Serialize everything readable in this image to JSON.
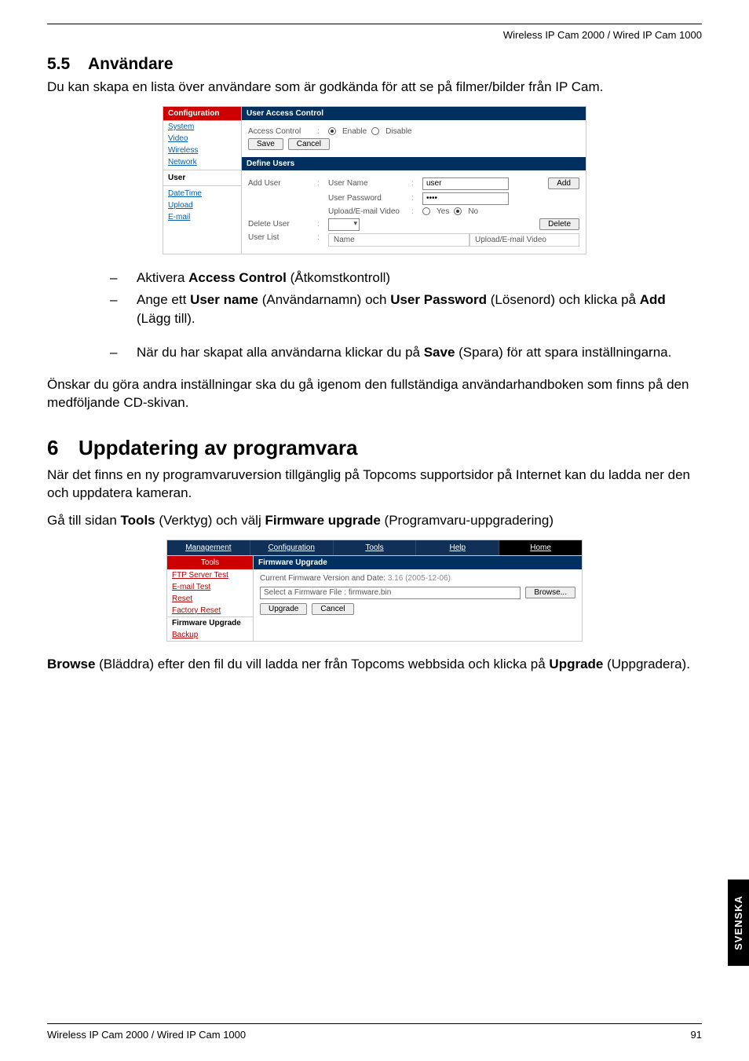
{
  "header_product": "Wireless IP Cam 2000 / Wired IP Cam 1000",
  "section55": {
    "num": "5.5",
    "title": "Användare",
    "intro": "Du kan skapa en lista över användare som är godkända för att se på filmer/bilder från IP Cam."
  },
  "panel1": {
    "tab_active": "Configuration",
    "nav": [
      "System",
      "Video",
      "Wireless",
      "Network"
    ],
    "nav_bold": "User",
    "nav2": [
      "DateTime",
      "Upload",
      "E-mail"
    ],
    "sec1_title": "User Access Control",
    "access_control_label": "Access Control",
    "enable": "Enable",
    "disable": "Disable",
    "save": "Save",
    "cancel": "Cancel",
    "sec2_title": "Define Users",
    "add_user": "Add User",
    "user_name_label": "User Name",
    "user_name_value": "user",
    "user_password_label": "User Password",
    "user_password_value": "••••",
    "upload_email_video": "Upload/E-mail Video",
    "yes": "Yes",
    "no": "No",
    "add_btn": "Add",
    "delete_user": "Delete User",
    "delete_btn": "Delete",
    "user_list": "User List",
    "col_name": "Name",
    "col_upload": "Upload/E-mail Video"
  },
  "bullets": {
    "b1a": "Aktivera ",
    "b1b": "Access Control",
    "b1c": " (Åtkomstkontroll)",
    "b2a": "Ange ett ",
    "b2b": "User name",
    "b2c": " (Användarnamn) och ",
    "b2d": "User Password",
    "b2e": " (Lösenord) och klicka på ",
    "b2f": "Add",
    "b2g": " (Lägg till).",
    "b3a": "När du har skapat alla användarna klickar du på ",
    "b3b": "Save",
    "b3c": " (Spara) för att spara inställningarna."
  },
  "para_after_bullets": "Önskar du göra andra inställningar ska du gå igenom den fullständiga användarhandboken som finns på den medföljande CD-skivan.",
  "section6": {
    "num": "6",
    "title": "Uppdatering av programvara",
    "p1": "När det finns en ny programvaruversion tillgänglig på Topcoms supportsidor på Internet kan du ladda ner den och uppdatera kameran.",
    "p2a": "Gå till sidan ",
    "p2b": "Tools",
    "p2c": " (Verktyg) och välj ",
    "p2d": "Firmware upgrade",
    "p2e": " (Programvaru-uppgradering)"
  },
  "panel2": {
    "tabs": [
      "Management",
      "Configuration",
      "Tools",
      "Help",
      "Home"
    ],
    "side_active": "Tools",
    "side": [
      "FTP Server Test",
      "E-mail Test",
      "Reset",
      "Factory Reset"
    ],
    "side_bold": "Firmware Upgrade",
    "side_after": [
      "Backup"
    ],
    "sec_title": "Firmware Upgrade",
    "fw_line_a": "Current Firmware Version and Date: ",
    "fw_line_b": "3.16 (2005-12-06)",
    "select_fw_label": "Select a Firmware File : ",
    "select_fw_value": "firmware.bin",
    "browse": "Browse...",
    "upgrade": "Upgrade",
    "cancel": "Cancel"
  },
  "closing": {
    "a": "Browse",
    "b": " (Bläddra) efter den fil du vill ladda ner från Topcoms webbsida och klicka på ",
    "c": "Upgrade",
    "d": " (Uppgradera)."
  },
  "lang_tab": "SVENSKA",
  "footer_left": "Wireless IP Cam 2000 / Wired IP Cam 1000",
  "footer_right": "91"
}
